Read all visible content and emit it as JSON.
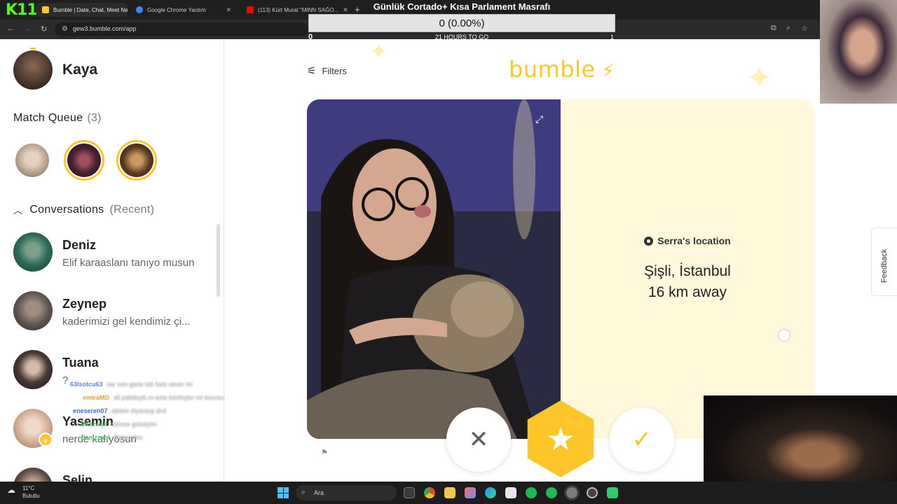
{
  "browser": {
    "tabs": [
      {
        "title": "Bumble | Date, Chat, Meet New...",
        "active": true
      },
      {
        "title": "Google Chrome Yardım",
        "active": false
      },
      {
        "title": "(113) Kürt Murat \"MINN SAĞO...",
        "active": false
      }
    ],
    "new_tab": "+",
    "url": "gew3.bumble.com/app",
    "overlay_logo": "K11"
  },
  "stream_goal": {
    "title": "Günlük Cortado+ Kısa Parlament Masrafı",
    "progress_text": "0 (0.00%)",
    "progress_fraction": 0,
    "min": "0",
    "countdown": "21 HOURS TO GO",
    "max": "1"
  },
  "sidebar": {
    "user_name": "Kaya",
    "match_queue_label": "Match Queue",
    "match_queue_count": "(3)",
    "conversations_label": "Conversations",
    "conversations_filter": "(Recent)",
    "conversations": [
      {
        "name": "Deniz",
        "message": "Elif karaaslanı tanıyo musun"
      },
      {
        "name": "Zeynep",
        "message": "kaderimizi gel kendimiz çi..."
      },
      {
        "name": "Tuana",
        "message": "?"
      },
      {
        "name": "Yasemin",
        "message": "nerde kalıyosun"
      },
      {
        "name": "Selin",
        "message": ""
      }
    ],
    "yasemin_badge": "+"
  },
  "chat_overlay": [
    {
      "user": "63lsotcu63",
      "color": "#5b8ad8",
      "text": "sar sen gene tek kale sever mi"
    },
    {
      "user": "emiraMD",
      "color": "#e0a040",
      "text": "ali pakdeyik.m anla kavfeşler mi sorusu gelsin"
    },
    {
      "user": "eneseren07",
      "color": "#3d6fd6",
      "text": "ablam diyorsuş dvd"
    },
    {
      "user": "0Karwell",
      "color": "#4fbf6a",
      "text": "servse gelseyim"
    },
    {
      "user": "denizzatil",
      "color": "#4fbf6a",
      "text": "fikmezdim"
    }
  ],
  "main": {
    "filters_label": "Filters",
    "logo": "bumble",
    "profile": {
      "location_label": "Serra's location",
      "city": "Şişli, İstanbul",
      "distance": "16 km away"
    },
    "actions": {
      "pass": "✕",
      "superswipe": "★",
      "like": "✓"
    }
  },
  "feedback_label": "Feedback",
  "taskbar": {
    "temperature": "11°C",
    "condition": "Bulutlu",
    "search_placeholder": "Ara"
  },
  "colors": {
    "brand": "#ffc629",
    "card_bg": "#fff8da",
    "chrome_dark": "#1f1f1f"
  }
}
